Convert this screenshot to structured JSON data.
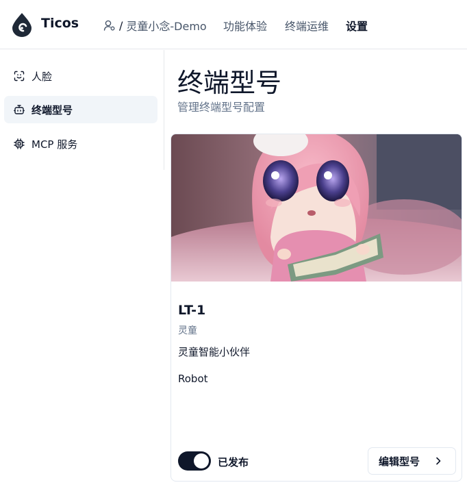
{
  "app": {
    "name": "Ticos"
  },
  "breadcrumb": {
    "separator": "/",
    "project": "灵童小念-Demo"
  },
  "nav": {
    "items": [
      "功能体验",
      "终端运维",
      "设置"
    ],
    "active": "设置"
  },
  "sidebar": {
    "items": [
      {
        "label": "人脸",
        "icon": "face-scan-icon"
      },
      {
        "label": "终端型号",
        "icon": "robot-icon",
        "active": true
      },
      {
        "label": "MCP 服务",
        "icon": "chip-icon"
      }
    ]
  },
  "page": {
    "title": "终端型号",
    "subtitle": "管理终端型号配置"
  },
  "card": {
    "name": "LT-1",
    "brand": "灵童",
    "description": "灵童智能小伙伴",
    "type": "Robot",
    "published": true,
    "published_label": "已发布",
    "edit_label": "编辑型号"
  }
}
